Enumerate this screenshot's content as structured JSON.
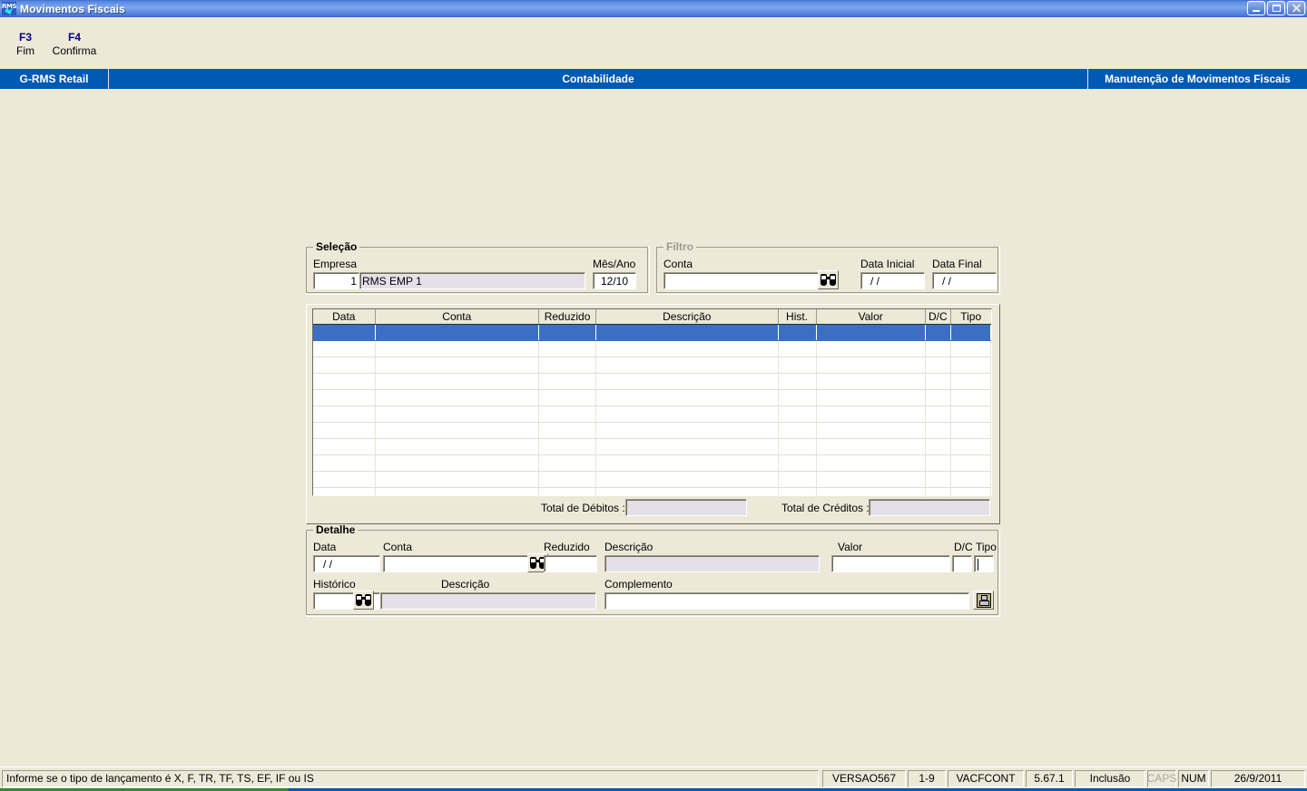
{
  "window": {
    "title": "Movimentos Fiscais",
    "icon": "rms-app-icon",
    "buttons": {
      "minimize": "minimize-button",
      "restore": "restore-button",
      "close": "close-button"
    }
  },
  "function_keys": [
    {
      "key": "F3",
      "desc": "Fim"
    },
    {
      "key": "F4",
      "desc": "Confirma"
    }
  ],
  "banner": {
    "left": "G-RMS Retail",
    "center": "Contabilidade",
    "right": "Manutenção de Movimentos Fiscais"
  },
  "selecao": {
    "title": "Seleção",
    "empresa_label": "Empresa",
    "empresa_code": "1",
    "empresa_name": "RMS EMP 1",
    "mesano_label": "Mês/Ano",
    "mesano_value": "12/10"
  },
  "filtro": {
    "title": "Filtro",
    "conta_label": "Conta",
    "conta_value": "",
    "conta_search_icon": "binoculars-icon",
    "data_inicial_label": "Data Inicial",
    "data_inicial_value": "/  /",
    "data_final_label": "Data Final",
    "data_final_value": "/  /"
  },
  "grid": {
    "columns": [
      "Data",
      "Conta",
      "Reduzido",
      "Descrição",
      "Hist.",
      "Valor",
      "D/C",
      "Tipo"
    ],
    "rows": [
      {
        "selected": true,
        "cells": [
          "",
          "",
          "",
          "",
          "",
          "",
          "",
          ""
        ]
      },
      {
        "selected": false,
        "cells": [
          "",
          "",
          "",
          "",
          "",
          "",
          "",
          ""
        ]
      },
      {
        "selected": false,
        "cells": [
          "",
          "",
          "",
          "",
          "",
          "",
          "",
          ""
        ]
      },
      {
        "selected": false,
        "cells": [
          "",
          "",
          "",
          "",
          "",
          "",
          "",
          ""
        ]
      },
      {
        "selected": false,
        "cells": [
          "",
          "",
          "",
          "",
          "",
          "",
          "",
          ""
        ]
      },
      {
        "selected": false,
        "cells": [
          "",
          "",
          "",
          "",
          "",
          "",
          "",
          ""
        ]
      },
      {
        "selected": false,
        "cells": [
          "",
          "",
          "",
          "",
          "",
          "",
          "",
          ""
        ]
      },
      {
        "selected": false,
        "cells": [
          "",
          "",
          "",
          "",
          "",
          "",
          "",
          ""
        ]
      },
      {
        "selected": false,
        "cells": [
          "",
          "",
          "",
          "",
          "",
          "",
          "",
          ""
        ]
      },
      {
        "selected": false,
        "cells": [
          "",
          "",
          "",
          "",
          "",
          "",
          "",
          ""
        ]
      },
      {
        "selected": false,
        "cells": [
          "",
          "",
          "",
          "",
          "",
          "",
          "",
          ""
        ]
      }
    ]
  },
  "totals": {
    "debitos_label": "Total de Débitos :",
    "debitos_value": "",
    "creditos_label": "Total de Créditos :",
    "creditos_value": ""
  },
  "detalhe": {
    "title": "Detalhe",
    "data_label": "Data",
    "data_value": "/  /",
    "conta_label": "Conta",
    "conta_value": "",
    "conta_search_icon": "binoculars-icon",
    "reduzido_label": "Reduzido",
    "reduzido_value": "",
    "descricao_label": "Descrição",
    "descricao_value": "",
    "valor_label": "Valor",
    "valor_value": "",
    "dc_label": "D/C",
    "dc_value": "",
    "tipo_label": "Tipo",
    "tipo_value": "",
    "historico_label": "Histórico",
    "historico_value": "",
    "historico_search_icon": "binoculars-icon",
    "hist_descricao_label": "Descrição",
    "hist_descricao_value": "",
    "complemento_label": "Complemento",
    "complemento_value": "",
    "save_icon": "floppy-save-icon"
  },
  "statusbar": {
    "message": "Informe se o tipo de lançamento é X, F, TR, TF, TS, EF, IF ou IS",
    "version": "VERSAO567",
    "range": "1-9",
    "program": "VACFCONT",
    "release": "5.67.1",
    "mode": "Inclusão",
    "caps": "CAPS",
    "num": "NUM",
    "date": "26/9/2011"
  },
  "colors": {
    "banner_blue": "#0059b3",
    "selection_blue": "#3a6fc4",
    "window_bg": "#ece9d8",
    "fkey_blue": "#000080"
  }
}
